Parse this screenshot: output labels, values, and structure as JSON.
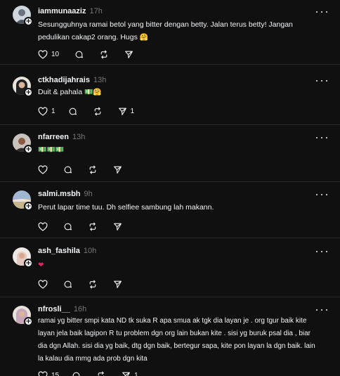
{
  "colors": {
    "background": "#101010",
    "text": "#f3f5f7",
    "muted": "#777777",
    "heart_emoji": "#e0245e"
  },
  "posts": [
    {
      "username": "iammunaaziz",
      "time": "17h",
      "text": "Sesungguhnya ramai betol yang bitter dengan betty. Jalan terus betty! Jangan pedulikan cakap2 orang. Hugs",
      "emoji": "smiling-face-with-hands",
      "likes": "10",
      "reposts": ""
    },
    {
      "username": "ctkhadijahrais",
      "time": "13h",
      "text": "Duit & pahala",
      "emoji": "money-and-hugging-face",
      "likes": "1",
      "shares": "1"
    },
    {
      "username": "nfarreen",
      "time": "13h",
      "text": "",
      "emoji": "money-stacks"
    },
    {
      "username": "salmi.msbh",
      "time": "9h",
      "text": "Perut lapar time tuu. Dh selfiee sambung lah makann."
    },
    {
      "username": "ash_fashila",
      "time": "10h",
      "text": "",
      "emoji": "red-heart"
    },
    {
      "username": "nfrosli__",
      "time": "16h",
      "text": "ramai yg bitter smpi kata ND tk suka R apa smua ak tgk dia layan je . org tgur baik kite layan jela baik lagipon R tu problem dgn org lain bukan kite . sisi yg buruk psal dia , biar dia dgn Allah. sisi dia yg baik, dtg dgn baik, bertegur sapa, kite pon layan la dgn baik. lain la kalau dia mmg ada prob dgn kita",
      "likes": "15",
      "shares": "1"
    }
  ],
  "icons": {
    "like": "heart-outline-icon",
    "reply": "speech-bubble-icon",
    "repost": "repost-arrows-icon",
    "share": "paper-plane-icon",
    "more": "more-dots-icon",
    "follow": "plus-badge-icon"
  }
}
